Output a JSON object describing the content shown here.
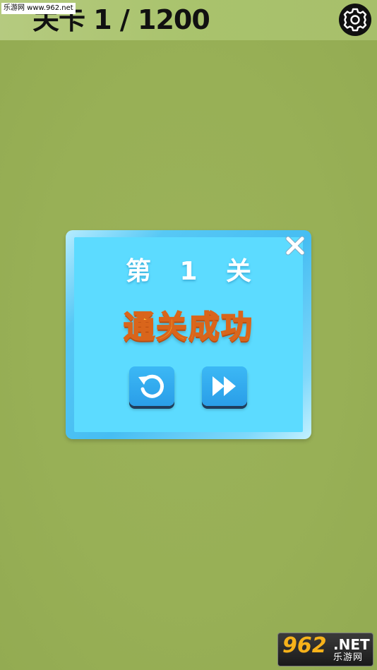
{
  "header": {
    "level_counter": "关卡 1 / 1200"
  },
  "watermark_top": "乐游网 www.962.net",
  "dialog": {
    "level_title": "第 1 关",
    "success_text": "通关成功",
    "retry_icon": "retry-icon",
    "next_icon": "fast-forward-icon",
    "close_icon": "close-icon"
  },
  "watermark_bottom": {
    "number": "962",
    "suffix": ".NET",
    "chinese": "乐游网"
  },
  "colors": {
    "background": "#98b056",
    "dialog_fill": "#5cdbff",
    "button_blue": "#2a9ee8",
    "success_text": "#ffcf3a"
  }
}
